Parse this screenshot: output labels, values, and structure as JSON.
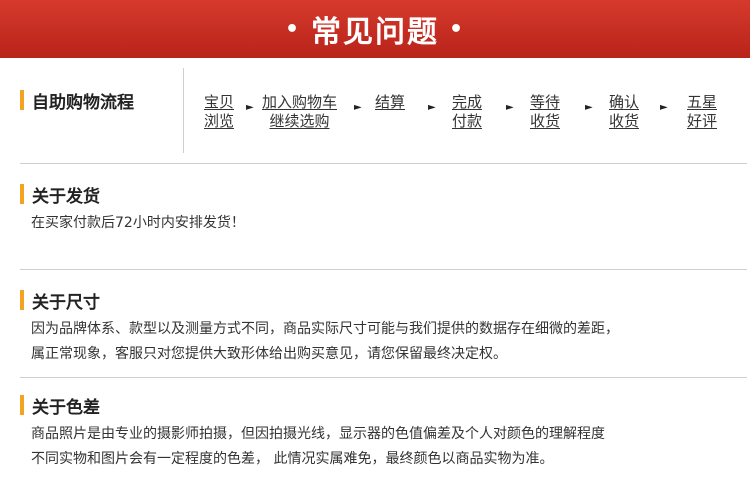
{
  "banner": {
    "title": "常见问题",
    "dot": "•"
  },
  "shopping": {
    "heading": "自助购物流程",
    "steps": [
      {
        "line1": "宝贝",
        "line2": "浏览"
      },
      {
        "line1": "加入购物车",
        "line2": "继续选购"
      },
      {
        "line1": "结算",
        "line2": ""
      },
      {
        "line1": "完成",
        "line2": "付款"
      },
      {
        "line1": "等待",
        "line2": "收货"
      },
      {
        "line1": "确认",
        "line2": "收货"
      },
      {
        "line1": "五星",
        "line2": "好评"
      }
    ],
    "arrow": "►"
  },
  "shipping": {
    "heading": "关于发货",
    "text": "在买家付款后72小时内安排发货！"
  },
  "size": {
    "heading": "关于尺寸",
    "line1": "因为品牌体系、款型以及测量方式不同，商品实际尺寸可能与我们提供的数据存在细微的差距，",
    "line2": "属正常现象，客服只对您提供大致形体给出购买意见，请您保留最终决定权。"
  },
  "color": {
    "heading": "关于色差",
    "line1": "商品照片是由专业的摄影师拍摄，但因拍摄光线，显示器的色值偏差及个人对颜色的理解程度",
    "line2": "不同实物和图片会有一定程度的色差， 此情况实属难免，最终颜色以商品实物为准。"
  }
}
